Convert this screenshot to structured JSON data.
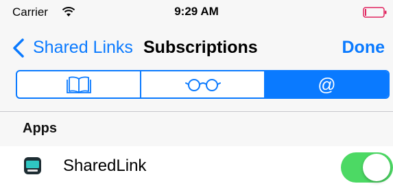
{
  "status_bar": {
    "carrier": "Carrier",
    "time": "9:29 AM",
    "wifi_icon": "wifi-icon",
    "battery_icon": "battery-icon",
    "battery_color": "#e0245e"
  },
  "nav": {
    "back_label": "Shared Links",
    "title": "Subscriptions",
    "done_label": "Done",
    "accent_color": "#0a7aff"
  },
  "segmented_control": {
    "segments": [
      {
        "icon": "book-icon",
        "selected": false
      },
      {
        "icon": "glasses-icon",
        "selected": false
      },
      {
        "icon": "mention-icon",
        "glyph": "@",
        "selected": true
      }
    ]
  },
  "section": {
    "header": "Apps"
  },
  "rows": [
    {
      "icon": "sharedlink-app-icon",
      "label": "SharedLink",
      "toggle_on": true,
      "toggle_color": "#4cd964"
    }
  ]
}
